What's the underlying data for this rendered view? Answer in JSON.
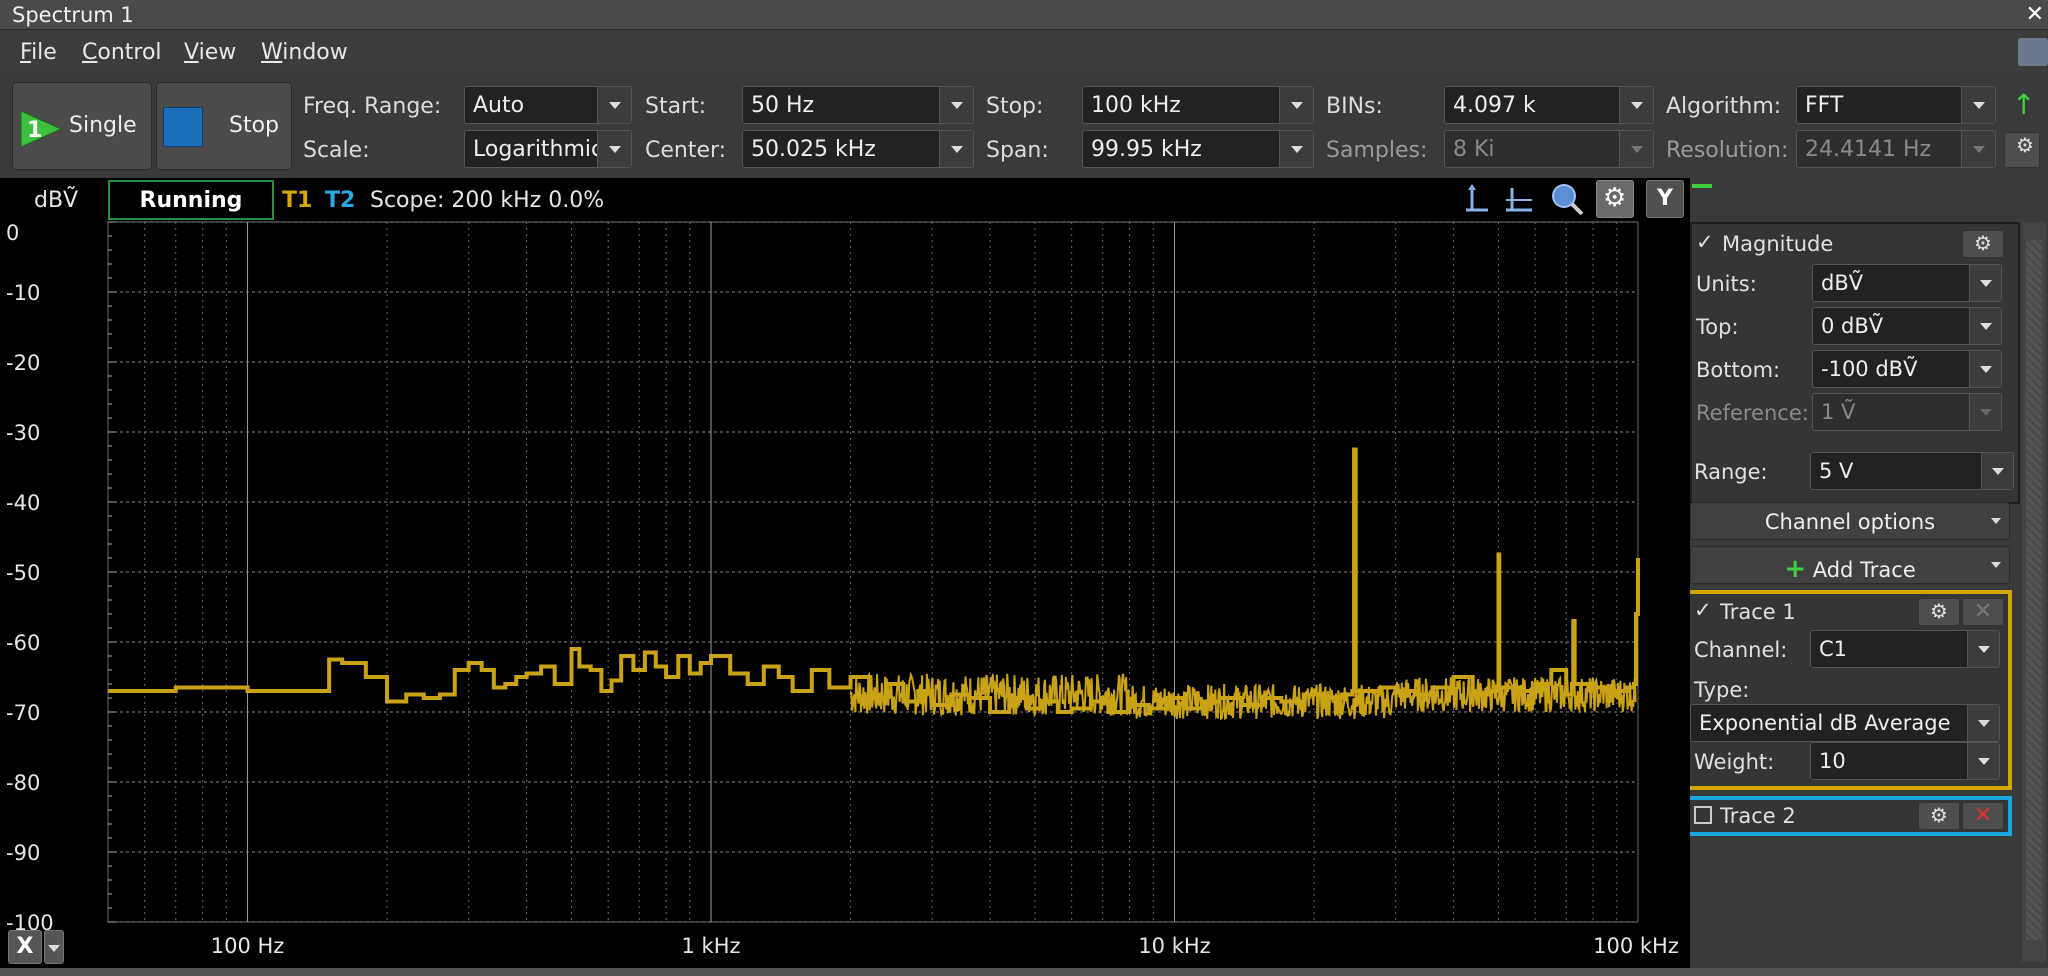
{
  "window": {
    "title": "Spectrum 1"
  },
  "menu": [
    "File",
    "Control",
    "View",
    "Window"
  ],
  "toolbar": {
    "single_label": "Single",
    "single_number": "1",
    "stop_label": "Stop",
    "freq_range_label": "Freq. Range:",
    "freq_range_value": "Auto",
    "scale_label": "Scale:",
    "scale_value": "Logarithmic",
    "start_label": "Start:",
    "start_value": "50 Hz",
    "center_label": "Center:",
    "center_value": "50.025 kHz",
    "stop_freq_label": "Stop:",
    "stop_freq_value": "100 kHz",
    "span_label": "Span:",
    "span_value": "99.95 kHz",
    "bins_label": "BINs:",
    "bins_value": "4.097 k",
    "samples_label": "Samples:",
    "samples_value": "8 Ki",
    "algorithm_label": "Algorithm:",
    "algorithm_value": "FFT",
    "resolution_label": "Resolution:",
    "resolution_value": "24.4141 Hz"
  },
  "plot_header": {
    "y_unit": "dBṼ",
    "status": "Running",
    "t1": "T1",
    "t2": "T2",
    "scope": "Scope: 200 kHz 0.0%",
    "y_btn": "Y",
    "x_btn": "X"
  },
  "panel": {
    "magnitude_label": "Magnitude",
    "units_label": "Units:",
    "units_value": "dBṼ",
    "top_label": "Top:",
    "top_value": "0 dBṼ",
    "bottom_label": "Bottom:",
    "bottom_value": "-100 dBṼ",
    "reference_label": "Reference:",
    "reference_value": "1 Ṽ",
    "range_label": "Range:",
    "range_value": "5 V",
    "channel_options": "Channel options",
    "add_trace": "Add Trace",
    "trace1": {
      "label": "Trace 1",
      "channel_label": "Channel:",
      "channel_value": "C1",
      "type_label": "Type:",
      "type_value": "Exponential dB Average",
      "weight_label": "Weight:",
      "weight_value": "10"
    },
    "trace2": {
      "label": "Trace 2"
    }
  },
  "colors": {
    "trace1": "#c9a216",
    "trace2": "#2aa7df",
    "trace1_box": "#d4a400",
    "trace2_box": "#19a6e0"
  },
  "chart_data": {
    "type": "line",
    "ylabel": "dBṼ",
    "xscale": "log",
    "xlim": [
      50,
      100000
    ],
    "ylim": [
      -100,
      0
    ],
    "y_ticks": [
      0,
      -10,
      -20,
      -30,
      -40,
      -50,
      -60,
      -70,
      -80,
      -90,
      -100
    ],
    "x_tick_labels": [
      {
        "value": 100,
        "label": "100 Hz"
      },
      {
        "value": 1000,
        "label": "1 kHz"
      },
      {
        "value": 10000,
        "label": "10 kHz"
      },
      {
        "value": 100000,
        "label": "100 kHz"
      }
    ],
    "grid": true,
    "series": [
      {
        "name": "T1",
        "x": [
          50,
          70,
          100,
          150,
          160,
          180,
          200,
          220,
          240,
          260,
          280,
          300,
          320,
          340,
          360,
          380,
          400,
          430,
          460,
          500,
          520,
          550,
          580,
          610,
          640,
          680,
          720,
          760,
          800,
          850,
          900,
          950,
          1000,
          1100,
          1200,
          1300,
          1400,
          1500,
          1650,
          1800,
          2000,
          2200,
          2400,
          2600,
          2800,
          3000,
          3300,
          3600,
          4000,
          4400,
          4800,
          5200,
          5600,
          6000,
          6600,
          7200,
          8000,
          8800,
          9600,
          10500,
          11500,
          12500,
          14000,
          15500,
          17000,
          19000,
          21000,
          23000,
          24200,
          24400,
          24600,
          26000,
          28000,
          30000,
          33000,
          36000,
          40000,
          44000,
          48000,
          49800,
          50000,
          50200,
          55000,
          60000,
          65000,
          70000,
          72000,
          72500,
          73000,
          80000,
          88000,
          95000,
          98000,
          99000,
          100000
        ],
        "values": [
          -67,
          -66.5,
          -67,
          -62.5,
          -63,
          -65,
          -68.5,
          -67.5,
          -68,
          -67.5,
          -64,
          -63,
          -64,
          -66.5,
          -66,
          -65,
          -64.5,
          -63.5,
          -66,
          -61,
          -63.5,
          -64,
          -67,
          -65.5,
          -62,
          -64,
          -61.5,
          -63.5,
          -65,
          -62,
          -64.5,
          -63,
          -62,
          -64.5,
          -66,
          -63.5,
          -65,
          -67,
          -64,
          -66.5,
          -65,
          -68,
          -66,
          -68.5,
          -67,
          -69,
          -67.5,
          -68,
          -70,
          -68,
          -69.5,
          -68.5,
          -70,
          -69.5,
          -68.5,
          -70,
          -69,
          -69.5,
          -68,
          -69.5,
          -68.5,
          -68,
          -69,
          -68,
          -68.5,
          -67.5,
          -68,
          -67.5,
          -67,
          -32.5,
          -67,
          -67,
          -66.5,
          -67,
          -67.5,
          -66.5,
          -65,
          -67.5,
          -67,
          -66.5,
          -47.5,
          -66.5,
          -67,
          -66,
          -64,
          -67.5,
          -66,
          -57,
          -66,
          -66.5,
          -67,
          -66.5,
          -66,
          -56,
          -48
        ]
      }
    ]
  }
}
